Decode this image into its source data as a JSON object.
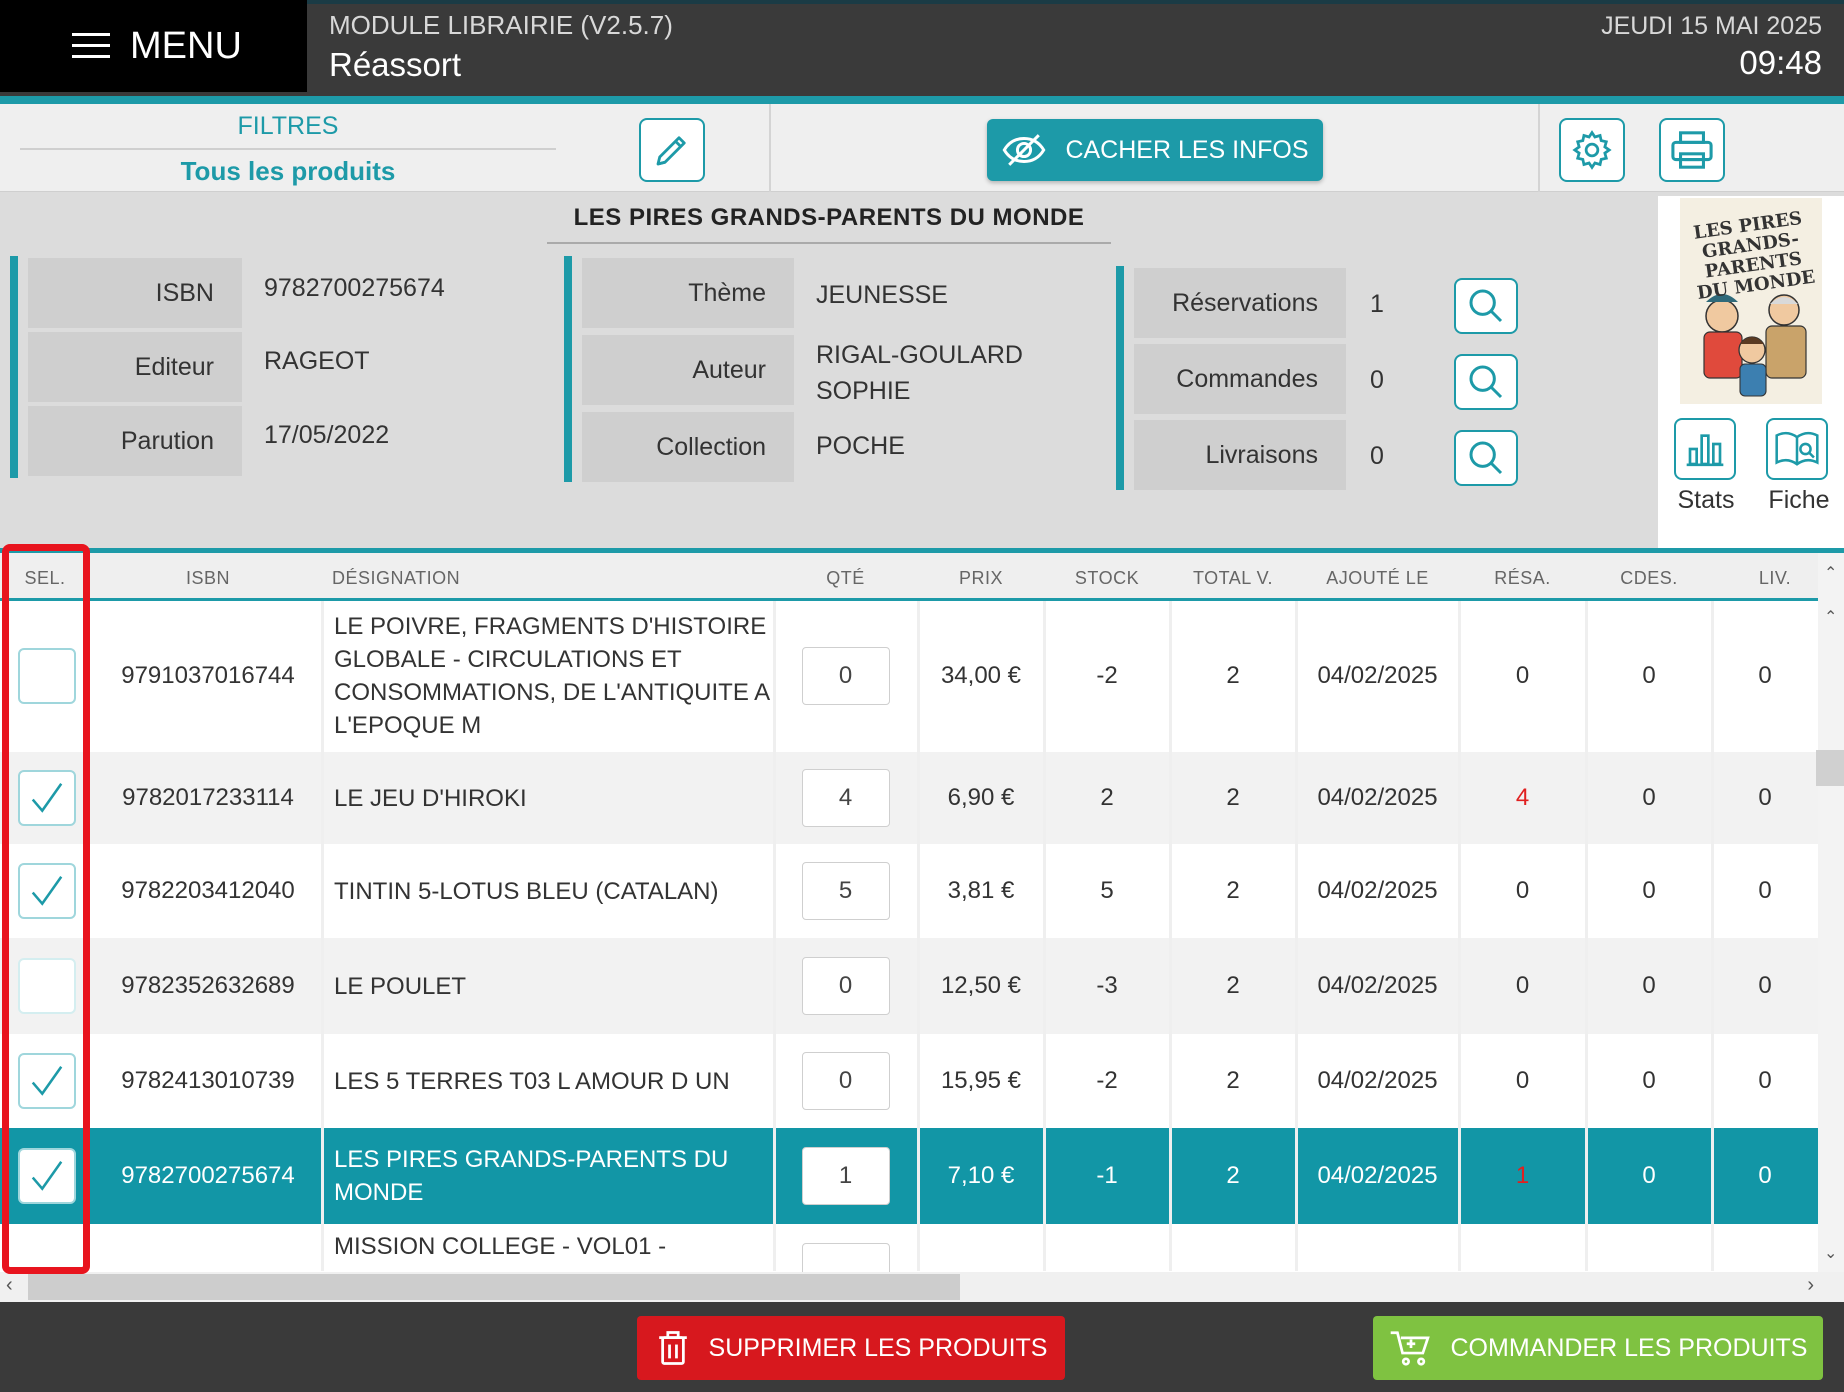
{
  "header": {
    "menu_label": "MENU",
    "module": "MODULE LIBRAIRIE (V2.5.7)",
    "section": "Réassort",
    "date": "JEUDI 15 MAI 2025",
    "time": "09:48"
  },
  "toolbar": {
    "filters_label": "FILTRES",
    "filters_value": "Tous les produits",
    "hide_info_label": "CACHER LES INFOS"
  },
  "product": {
    "title": "LES PIRES GRANDS-PARENTS DU MONDE",
    "fields_left": [
      {
        "label": "ISBN",
        "value": "9782700275674"
      },
      {
        "label": "Editeur",
        "value": "RAGEOT"
      },
      {
        "label": "Parution",
        "value": "17/05/2022"
      }
    ],
    "fields_mid": [
      {
        "label": "Thème",
        "value": "JEUNESSE"
      },
      {
        "label": "Auteur",
        "value": "RIGAL-GOULARD SOPHIE"
      },
      {
        "label": "Collection",
        "value": "POCHE"
      }
    ],
    "fields_right": [
      {
        "label": "Réservations",
        "value": "1"
      },
      {
        "label": "Commandes",
        "value": "0"
      },
      {
        "label": "Livraisons",
        "value": "0"
      }
    ],
    "cover_text": "LES PIRES GRANDS-PARENTS DU MONDE",
    "stats_label": "Stats",
    "fiche_label": "Fiche"
  },
  "table": {
    "headers": [
      "SEL.",
      "ISBN",
      "DÉSIGNATION",
      "QTÉ",
      "PRIX",
      "STOCK",
      "TOTAL V.",
      "AJOUTÉ LE",
      "RÉSA.",
      "CDES.",
      "LIV."
    ],
    "rows": [
      {
        "checked": false,
        "isbn": "9791037016744",
        "designation": "LE POIVRE, FRAGMENTS D'HISTOIRE GLOBALE - CIRCULATIONS ET CONSOMMATIONS, DE L'ANTIQUITE A L'EPOQUE M",
        "qte": "0",
        "prix": "34,00 €",
        "stock": "-2",
        "total": "2",
        "ajoute": "04/02/2025",
        "resa": "0",
        "cdes": "0",
        "liv": "0"
      },
      {
        "checked": true,
        "isbn": "9782017233114",
        "designation": "LE JEU D'HIROKI",
        "qte": "4",
        "prix": "6,90 €",
        "stock": "2",
        "total": "2",
        "ajoute": "04/02/2025",
        "resa": "4",
        "cdes": "0",
        "liv": "0"
      },
      {
        "checked": true,
        "isbn": "9782203412040",
        "designation": "TINTIN 5-LOTUS BLEU (CATALAN)",
        "qte": "5",
        "prix": "3,81 €",
        "stock": "5",
        "total": "2",
        "ajoute": "04/02/2025",
        "resa": "0",
        "cdes": "0",
        "liv": "0"
      },
      {
        "checked": false,
        "isbn": "9782352632689",
        "designation": "LE POULET",
        "qte": "0",
        "prix": "12,50 €",
        "stock": "-3",
        "total": "2",
        "ajoute": "04/02/2025",
        "resa": "0",
        "cdes": "0",
        "liv": "0"
      },
      {
        "checked": true,
        "isbn": "9782413010739",
        "designation": "LES 5 TERRES T03 L AMOUR D UN",
        "qte": "0",
        "prix": "15,95 €",
        "stock": "-2",
        "total": "2",
        "ajoute": "04/02/2025",
        "resa": "0",
        "cdes": "0",
        "liv": "0"
      },
      {
        "checked": true,
        "isbn": "9782700275674",
        "designation": "LES PIRES GRANDS-PARENTS DU MONDE",
        "qte": "1",
        "prix": "7,10 €",
        "stock": "-1",
        "total": "2",
        "ajoute": "04/02/2025",
        "resa": "1",
        "cdes": "0",
        "liv": "0"
      },
      {
        "checked": false,
        "isbn": "",
        "designation": "MISSION COLLEGE - VOL01 -",
        "qte": "",
        "prix": "",
        "stock": "",
        "total": "",
        "ajoute": "",
        "resa": "",
        "cdes": "",
        "liv": ""
      }
    ]
  },
  "footer": {
    "delete_label": "SUPPRIMER LES PRODUITS",
    "order_label": "COMMANDER LES PRODUITS"
  },
  "colors": {
    "accent": "#1d9aa8",
    "danger": "#d7181e",
    "success": "#7fc241",
    "highlight": "#e8141e"
  }
}
